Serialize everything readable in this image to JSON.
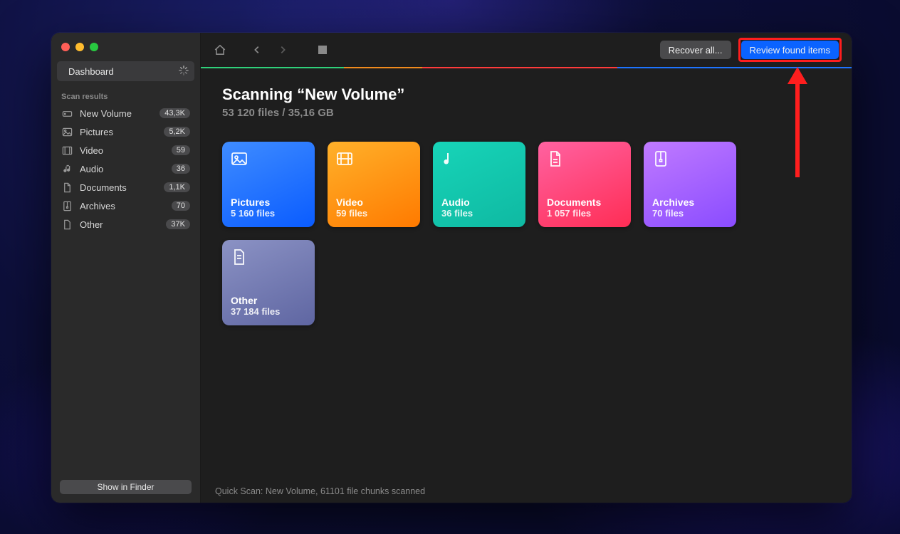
{
  "sidebar": {
    "dashboard_label": "Dashboard",
    "section_label": "Scan results",
    "items": [
      {
        "label": "New Volume",
        "count": "43,3K"
      },
      {
        "label": "Pictures",
        "count": "5,2K"
      },
      {
        "label": "Video",
        "count": "59"
      },
      {
        "label": "Audio",
        "count": "36"
      },
      {
        "label": "Documents",
        "count": "1,1K"
      },
      {
        "label": "Archives",
        "count": "70"
      },
      {
        "label": "Other",
        "count": "37K"
      }
    ],
    "finder_button": "Show in Finder"
  },
  "toolbar": {
    "recover_label": "Recover all...",
    "review_label": "Review found items"
  },
  "scan": {
    "title": "Scanning “New Volume”",
    "subtitle": "53 120 files / 35,16 GB"
  },
  "cards": [
    {
      "title": "Pictures",
      "sub": "5 160 files"
    },
    {
      "title": "Video",
      "sub": "59 files"
    },
    {
      "title": "Audio",
      "sub": "36 files"
    },
    {
      "title": "Documents",
      "sub": "1 057 files"
    },
    {
      "title": "Archives",
      "sub": "70 files"
    },
    {
      "title": "Other",
      "sub": "37 184 files"
    }
  ],
  "status": "Quick Scan: New Volume, 61101 file chunks scanned"
}
